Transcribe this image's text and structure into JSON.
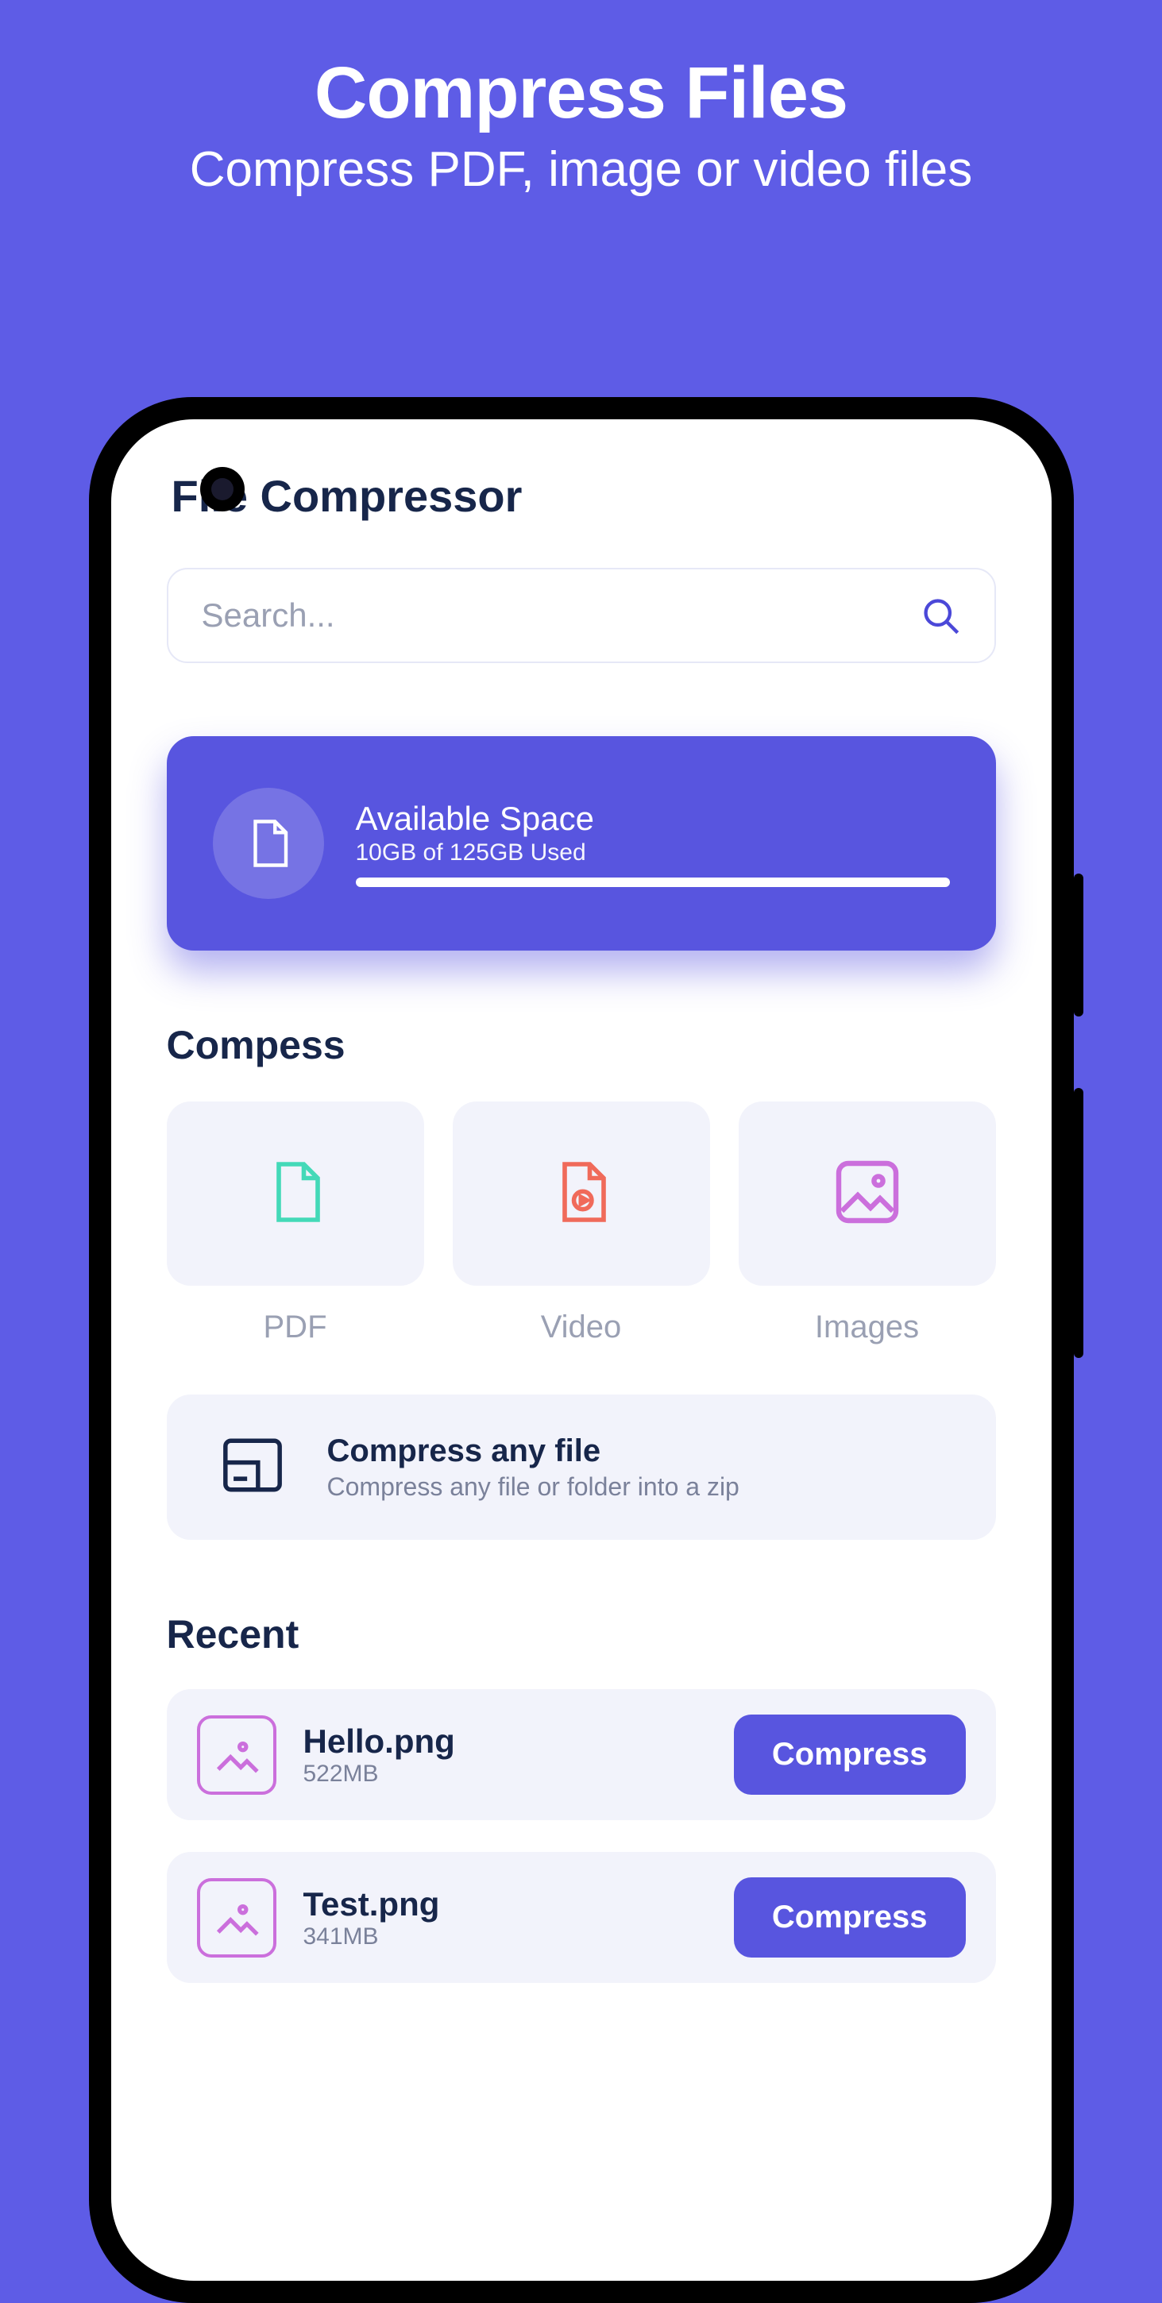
{
  "promo": {
    "title": "Compress Files",
    "subtitle": "Compress PDF, image or video files"
  },
  "app": {
    "title": "File Compressor"
  },
  "search": {
    "placeholder": "Search..."
  },
  "space": {
    "title": "Available Space",
    "usage": "10GB of 125GB Used"
  },
  "sections": {
    "compress": "Compess",
    "recent": "Recent"
  },
  "tiles": {
    "pdf": "PDF",
    "video": "Video",
    "images": "Images"
  },
  "anyfile": {
    "title": "Compress any file",
    "subtitle": "Compress any file or folder into a zip"
  },
  "recent": [
    {
      "name": "Hello.png",
      "size": "522MB",
      "action": "Compress"
    },
    {
      "name": "Test.png",
      "size": "341MB",
      "action": "Compress"
    }
  ]
}
